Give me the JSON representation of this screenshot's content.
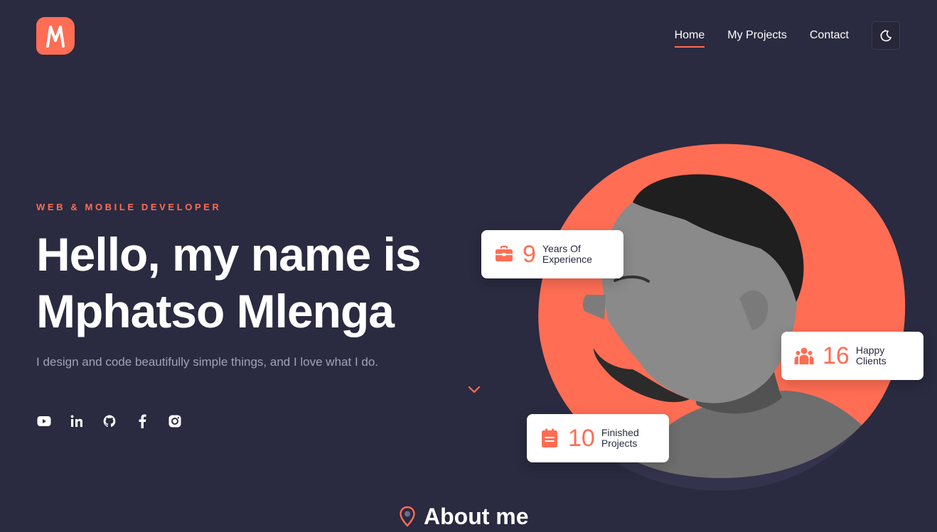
{
  "brand": {
    "logo_letter": "M"
  },
  "nav": {
    "items": [
      {
        "label": "Home",
        "active": true
      },
      {
        "label": "My Projects",
        "active": false
      },
      {
        "label": "Contact",
        "active": false
      }
    ],
    "theme_toggle_icon": "moon-icon"
  },
  "hero": {
    "eyebrow": "WEB & MOBILE DEVELOPER",
    "title_line1": "Hello, my name is",
    "title_line2": "Mphatso Mlenga",
    "description": "I design and code beautifully simple things, and I love what I do.",
    "socials": [
      "youtube-icon",
      "linkedin-icon",
      "github-icon",
      "facebook-icon",
      "instagram-icon"
    ],
    "scroll_icon": "chevron-down-icon"
  },
  "stats": [
    {
      "number": "9",
      "label_line1": "Years Of",
      "label_line2": "Experience",
      "icon": "briefcase-icon"
    },
    {
      "number": "16",
      "label_line1": "Happy",
      "label_line2": "Clients",
      "icon": "users-icon"
    },
    {
      "number": "10",
      "label_line1": "Finished",
      "label_line2": "Projects",
      "icon": "clipboard-icon"
    }
  ],
  "about": {
    "title": "About me",
    "icon": "location-pin-icon"
  },
  "colors": {
    "background": "#2a2a40",
    "accent": "#ff6d54",
    "muted_text": "#a3a3b5",
    "card": "#ffffff"
  }
}
